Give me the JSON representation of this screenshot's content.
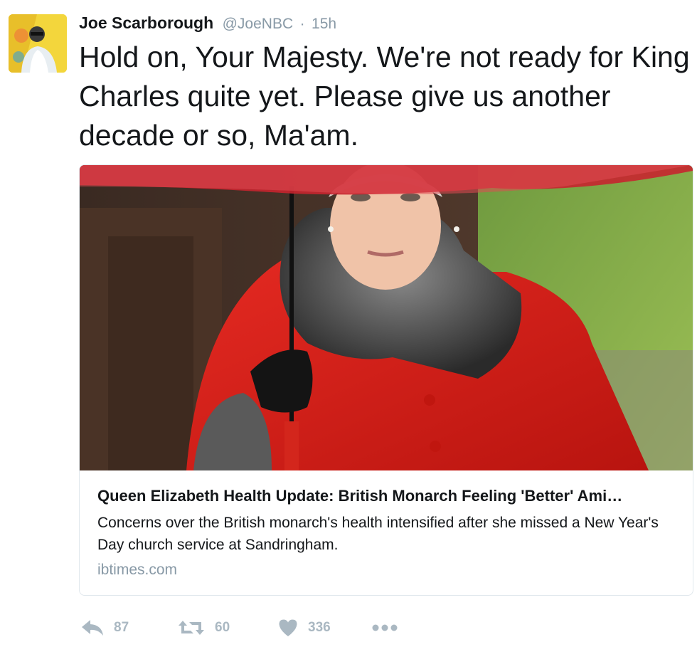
{
  "tweet": {
    "author_name": "Joe Scarborough",
    "handle": "@JoeNBC",
    "separator": "·",
    "time": "15h",
    "text": "Hold on, Your Majesty. We're not ready for King Charles quite yet. Please give us another decade or so, Ma'am."
  },
  "card": {
    "title": "Queen Elizabeth Health Update: British Monarch Feeling 'Better' Ami…",
    "description": "Concerns over the British monarch's health intensified after she missed a New Year's Day church service at Sandringham.",
    "domain": "ibtimes.com"
  },
  "actions": {
    "reply_count": "87",
    "retweet_count": "60",
    "like_count": "336"
  },
  "icons": {
    "reply": "reply-icon",
    "retweet": "retweet-icon",
    "like": "heart-icon",
    "more": "more-icon"
  },
  "colors": {
    "text": "#14171a",
    "secondary": "#8899a6",
    "action_icon": "#aab8c2",
    "card_border": "#e1e8ed"
  }
}
